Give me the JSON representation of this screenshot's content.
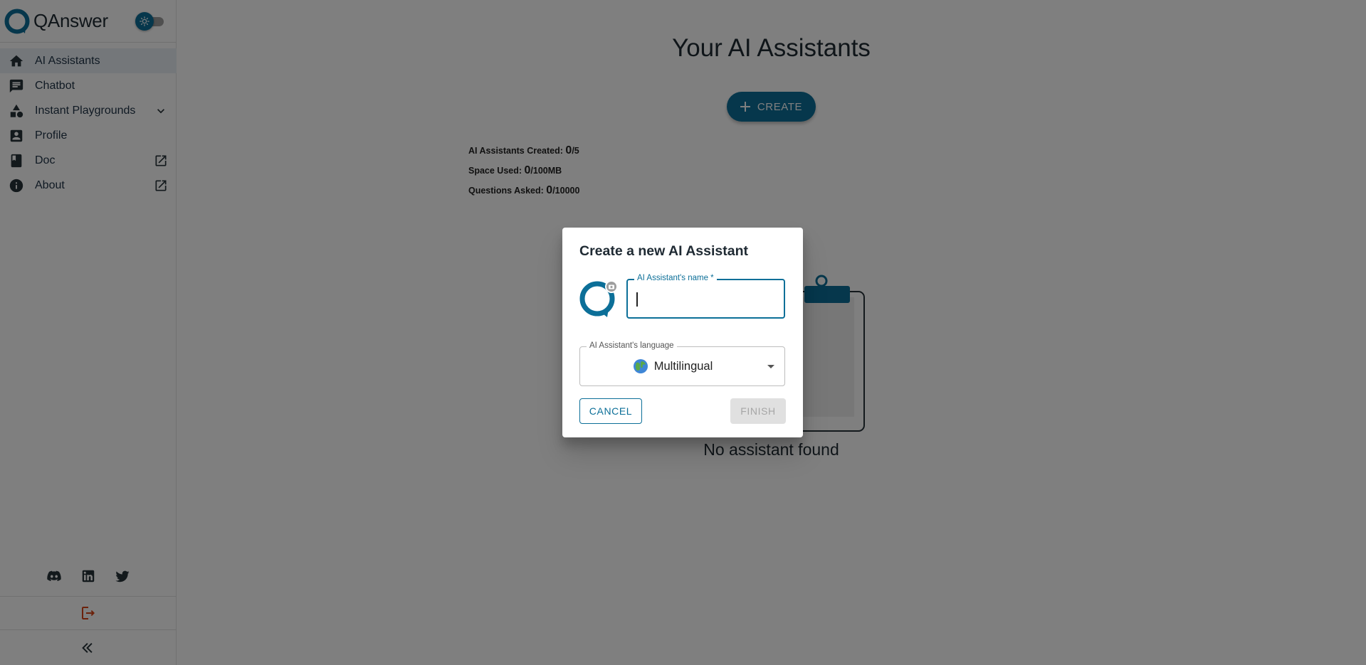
{
  "app": {
    "brand": "QAnswer",
    "accent_color": "#0c6f98"
  },
  "theme_toggle": {
    "state": "light",
    "icon": "sun-icon"
  },
  "sidebar": {
    "items": [
      {
        "label": "AI Assistants",
        "icon": "home-icon",
        "active": true
      },
      {
        "label": "Chatbot",
        "icon": "chat-icon"
      },
      {
        "label": "Instant Playgrounds",
        "icon": "shapes-icon",
        "trailing": "chevron-down-icon"
      },
      {
        "label": "Profile",
        "icon": "account-box-icon"
      },
      {
        "label": "Doc",
        "icon": "book-icon",
        "trailing": "open-in-new-icon"
      },
      {
        "label": "About",
        "icon": "info-icon",
        "trailing": "open-in-new-icon"
      }
    ],
    "social": [
      "discord-icon",
      "linkedin-icon",
      "twitter-icon"
    ],
    "logout_icon": "logout-icon",
    "collapse_icon": "double-chevron-left-icon"
  },
  "main": {
    "title": "Your AI Assistants",
    "create_label": "CREATE",
    "stats": {
      "created_label": "AI Assistants Created:",
      "created_value": "0",
      "created_limit": "/5",
      "space_label": "Space Used:",
      "space_value": "0",
      "space_limit": "/100MB",
      "questions_label": "Questions Asked:",
      "questions_value": "0",
      "questions_limit": "/10000"
    },
    "empty_text": "No assistant found"
  },
  "dialog": {
    "title": "Create a new AI Assistant",
    "name_field": {
      "label": "AI Assistant's name *",
      "value": ""
    },
    "language_field": {
      "label": "AI Assistant's language",
      "value": "Multilingual",
      "icon": "globe-icon"
    },
    "cancel_label": "CANCEL",
    "finish_label": "FINISH"
  }
}
